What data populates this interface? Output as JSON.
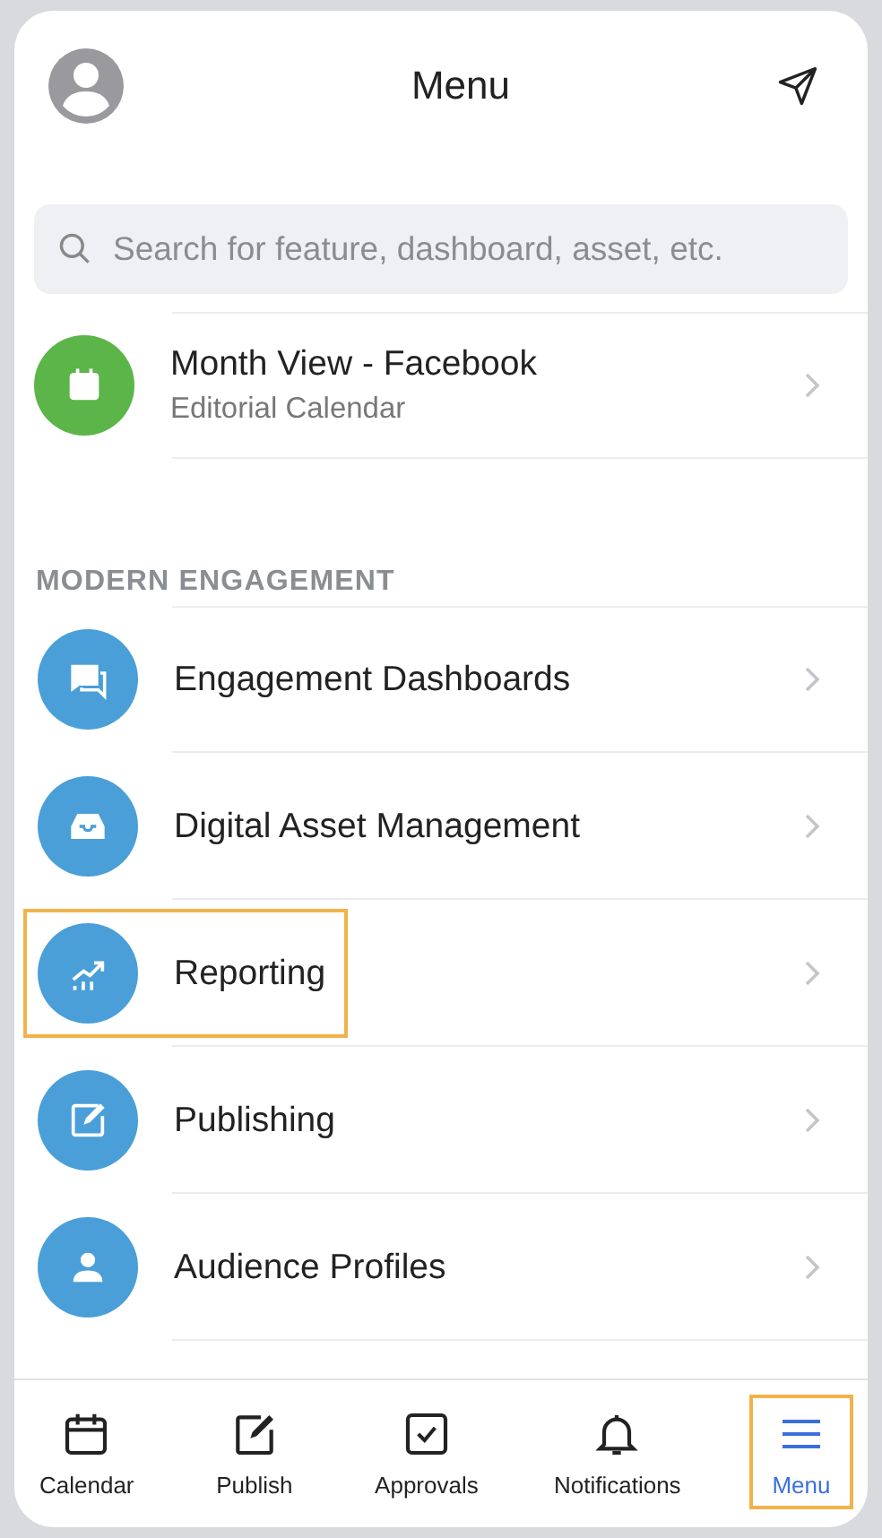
{
  "header": {
    "title": "Menu"
  },
  "search": {
    "placeholder": "Search for feature, dashboard, asset, etc."
  },
  "recent": [
    {
      "kind": "calendar",
      "color": "#5bb548",
      "title": "Month View - Facebook",
      "subtitle": "Editorial Calendar"
    }
  ],
  "section": {
    "label": "MODERN ENGAGEMENT",
    "items": [
      {
        "kind": "chat",
        "color": "#4a9fd8",
        "title": "Engagement Dashboards",
        "highlighted": false
      },
      {
        "kind": "inbox",
        "color": "#4a9fd8",
        "title": "Digital Asset Management",
        "highlighted": false
      },
      {
        "kind": "chart",
        "color": "#4a9fd8",
        "title": "Reporting",
        "highlighted": true
      },
      {
        "kind": "edit",
        "color": "#4a9fd8",
        "title": "Publishing",
        "highlighted": false
      },
      {
        "kind": "person",
        "color": "#4a9fd8",
        "title": "Audience Profiles",
        "highlighted": false
      }
    ]
  },
  "tabs": [
    {
      "kind": "calendar",
      "label": "Calendar",
      "selected": false
    },
    {
      "kind": "edit",
      "label": "Publish",
      "selected": false
    },
    {
      "kind": "check",
      "label": "Approvals",
      "selected": false
    },
    {
      "kind": "bell",
      "label": "Notifications",
      "selected": false
    },
    {
      "kind": "menu",
      "label": "Menu",
      "selected": true
    }
  ]
}
